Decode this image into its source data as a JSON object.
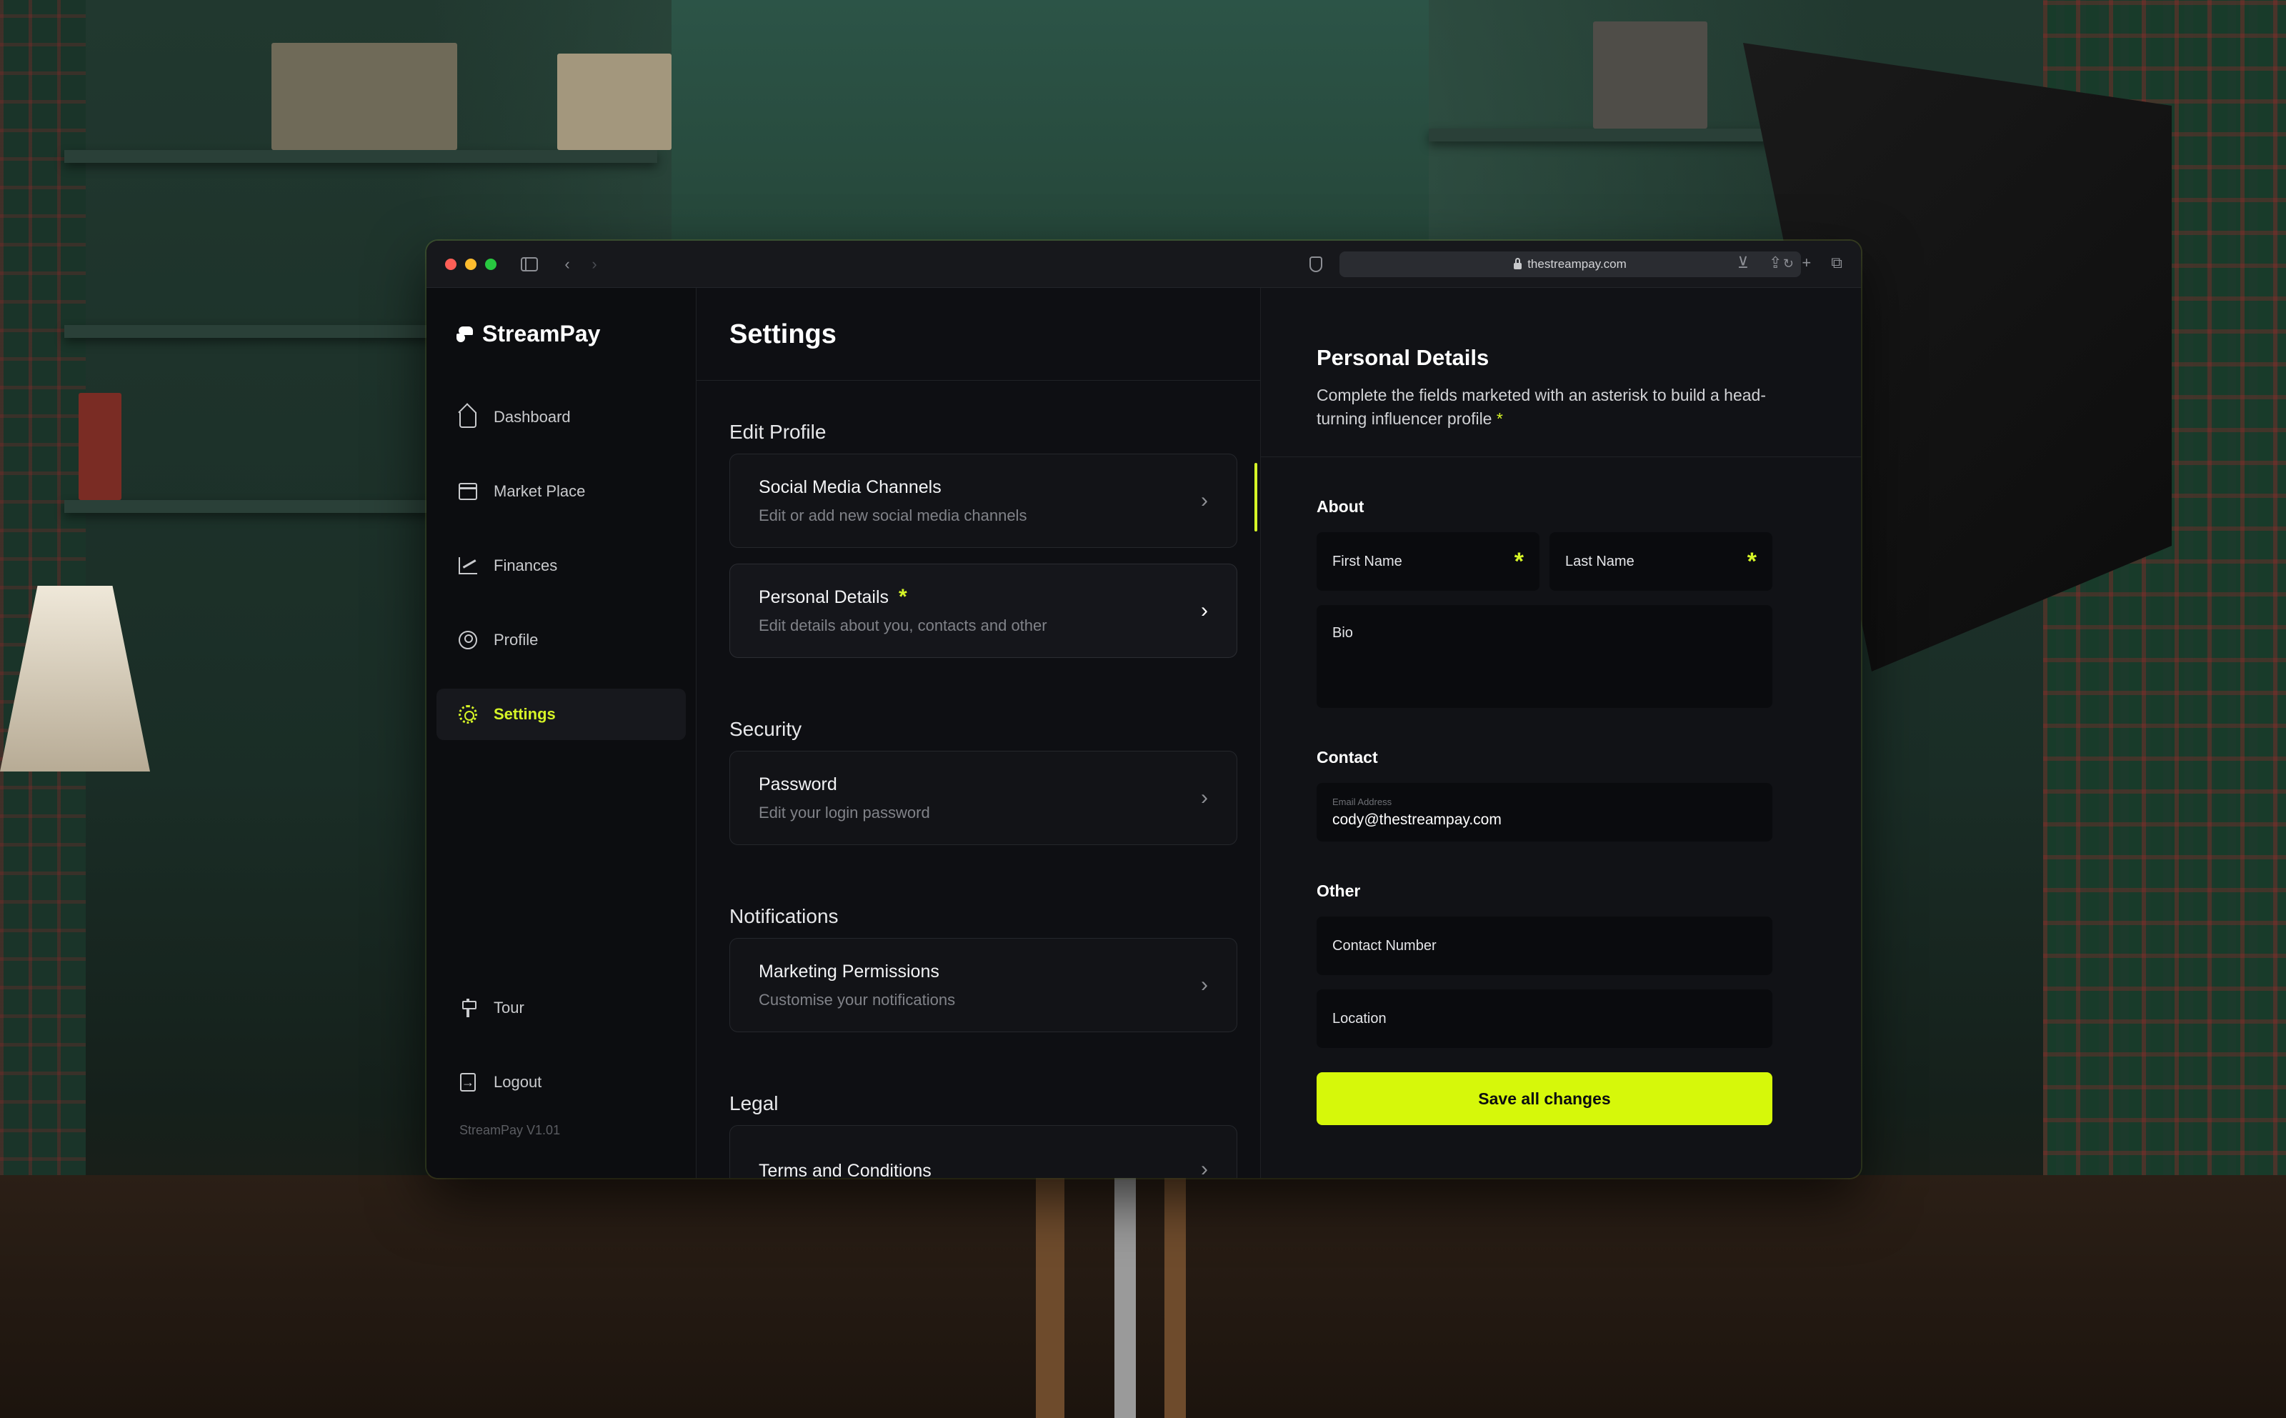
{
  "browser": {
    "url": "thestreampay.com"
  },
  "brand": {
    "name": "StreamPay"
  },
  "sidebar": {
    "items": [
      {
        "label": "Dashboard",
        "icon": "home-icon"
      },
      {
        "label": "Market Place",
        "icon": "store-icon"
      },
      {
        "label": "Finances",
        "icon": "chart-icon"
      },
      {
        "label": "Profile",
        "icon": "user-icon"
      },
      {
        "label": "Settings",
        "icon": "gear-icon",
        "active": true
      }
    ],
    "bottom": [
      {
        "label": "Tour",
        "icon": "signpost-icon"
      },
      {
        "label": "Logout",
        "icon": "logout-icon"
      }
    ],
    "version": "StreamPay V1.01"
  },
  "settings": {
    "title": "Settings",
    "sections": {
      "edit_profile": {
        "heading": "Edit Profile",
        "cards": [
          {
            "title": "Social Media Channels",
            "subtitle": "Edit or add new social media channels"
          },
          {
            "title": "Personal Details",
            "subtitle": "Edit details about you, contacts and other",
            "required_marker": "*"
          }
        ]
      },
      "security": {
        "heading": "Security",
        "cards": [
          {
            "title": "Password",
            "subtitle": "Edit your login password"
          }
        ]
      },
      "notifications": {
        "heading": "Notifications",
        "cards": [
          {
            "title": "Marketing Permissions",
            "subtitle": "Customise your notifications"
          }
        ]
      },
      "legal": {
        "heading": "Legal",
        "cards": [
          {
            "title": "Terms and Conditions"
          }
        ]
      }
    }
  },
  "personal_details": {
    "title": "Personal Details",
    "description": "Complete the fields marketed with an asterisk to build a head-turning influencer profile",
    "asterisk": "*",
    "about": {
      "heading": "About",
      "first_name_placeholder": "First Name",
      "last_name_placeholder": "Last Name",
      "bio_placeholder": "Bio"
    },
    "contact": {
      "heading": "Contact",
      "email_label": "Email Address",
      "email_value": "cody@thestreampay.com"
    },
    "other": {
      "heading": "Other",
      "contact_number_placeholder": "Contact Number",
      "location_placeholder": "Location"
    },
    "save_label": "Save all changes"
  },
  "colors": {
    "accent": "#d6f527",
    "button": "#d6f80a",
    "background": "#0d0e12"
  }
}
